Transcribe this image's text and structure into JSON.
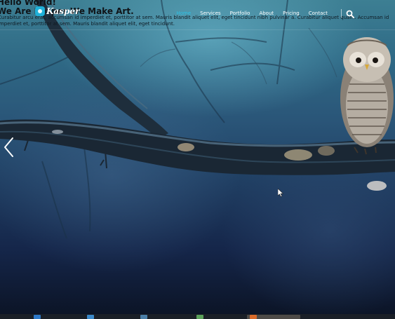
{
  "hero": {
    "hello": "Hello World!",
    "tagline": "We Are Kasper We Make Art.",
    "paragraph": "Curabitur arcu erat, accumsan id imperdiet et, porttitor at sem. Mauris blandit aliquet elit, eget tincidunt nibh pulvinar a. Curabitur aliquet quam. Accumsan id imperdiet et, porttitor at sem. Mauris blandit aliquet elit, eget tincidunt."
  },
  "logo": {
    "text": "Kasper",
    "icon": "kasper-logo-icon"
  },
  "nav": {
    "items": [
      {
        "label": "Home",
        "active": true
      },
      {
        "label": "Services",
        "active": false
      },
      {
        "label": "Portfolio",
        "active": false
      },
      {
        "label": "About",
        "active": false
      },
      {
        "label": "Pricing",
        "active": false
      },
      {
        "label": "Contact",
        "active": false
      }
    ],
    "search_icon": "search-icon"
  },
  "slider": {
    "prev_icon": "chevron-left-icon"
  },
  "colors": {
    "accent": "#2bc0e4",
    "nav_text": "#ffffff",
    "overlay_text": "#101418"
  }
}
